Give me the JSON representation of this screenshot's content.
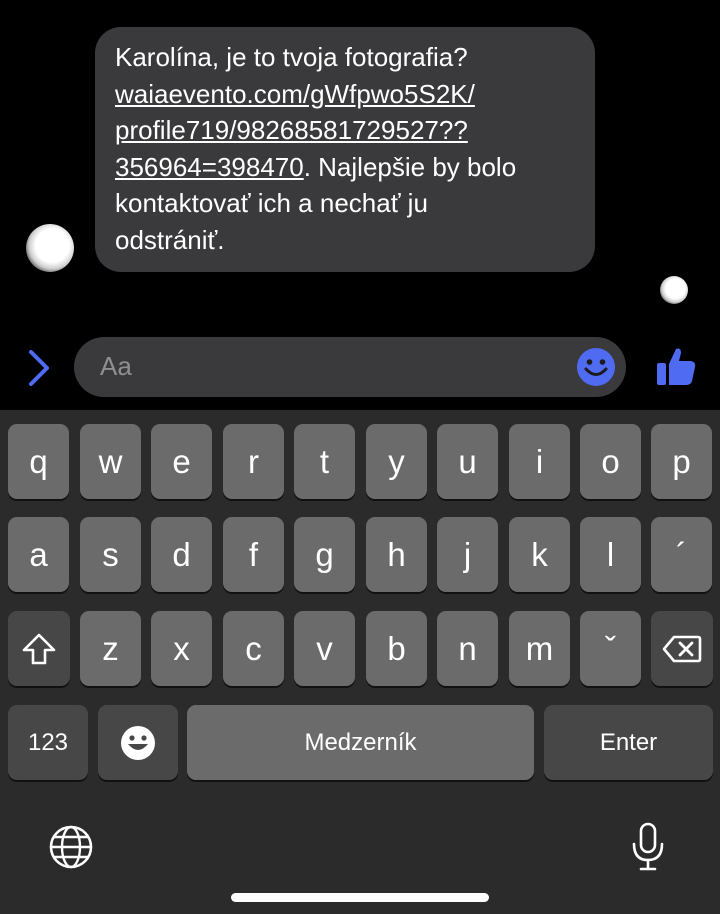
{
  "chat": {
    "message": {
      "line1": "Karolína, je to tvoja fotografia?",
      "link": "waiaevento.com/gWfpwo5S2K/\nprofile719/98268581729527??\n356964=398470",
      "rest": ". Najlepšie by bolo\nkontaktovať ich a nechať ju\nodstrániť."
    }
  },
  "composer": {
    "placeholder": "Aa",
    "accent": "#4f6bf2"
  },
  "keyboard": {
    "row1": [
      "q",
      "w",
      "e",
      "r",
      "t",
      "y",
      "u",
      "i",
      "o",
      "p"
    ],
    "row2": [
      "a",
      "s",
      "d",
      "f",
      "g",
      "h",
      "j",
      "k",
      "l",
      "´"
    ],
    "row3": [
      "z",
      "x",
      "c",
      "v",
      "b",
      "n",
      "m",
      "ˇ"
    ],
    "numbers_label": "123",
    "space_label": "Medzerník",
    "enter_label": "Enter"
  },
  "icons": [
    "chevron-right-icon",
    "smiley-icon",
    "thumbs-up-icon",
    "shift-icon",
    "backspace-icon",
    "emoji-icon",
    "globe-icon",
    "microphone-icon"
  ]
}
